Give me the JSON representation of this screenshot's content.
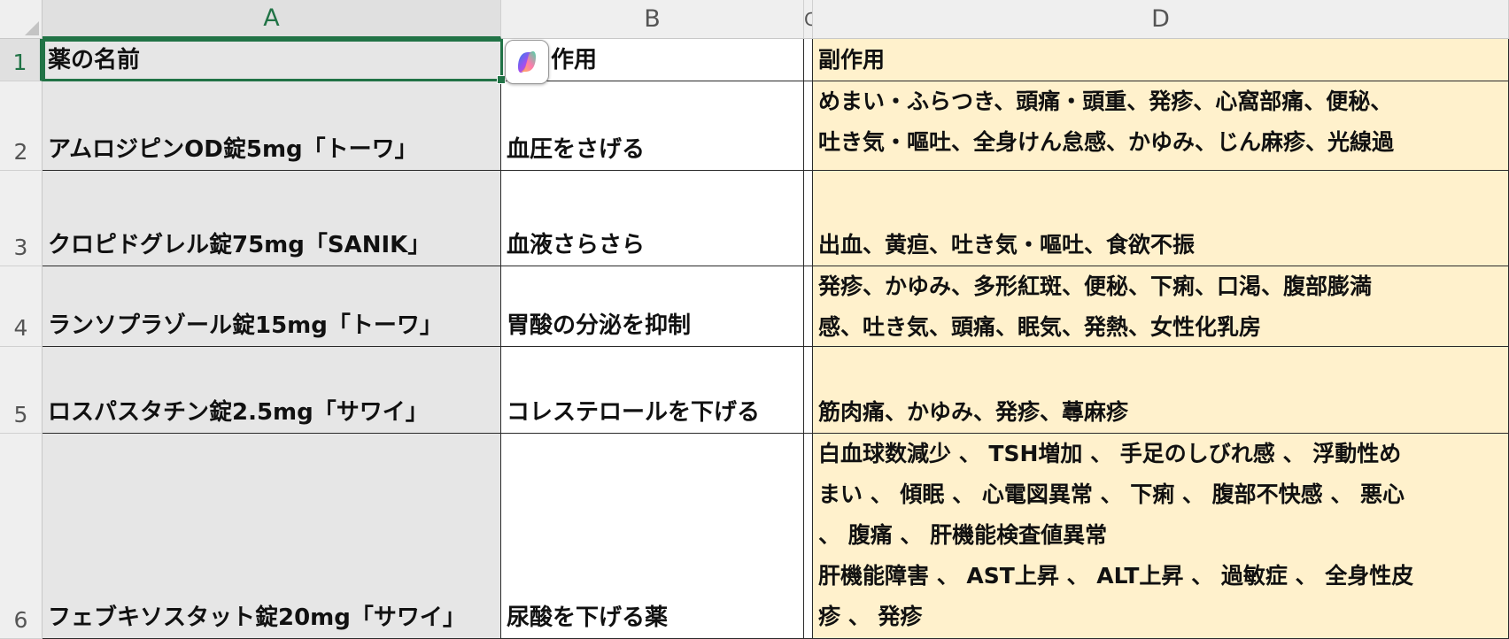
{
  "columns": [
    "A",
    "B",
    "C",
    "D"
  ],
  "rows": [
    "1",
    "2",
    "3",
    "4",
    "5",
    "6"
  ],
  "header": {
    "name": "薬の名前",
    "effect": "作用",
    "side_effects": "副作用"
  },
  "records": [
    {
      "name": "アムロジピンOD錠5mg「トーワ」",
      "effect": "血圧をさげる",
      "side_effects": "めまい・ふらつき、頭痛・頭重、発疹、心窩部痛、便秘、\n吐き気・嘔吐、全身けん怠感、かゆみ、じん麻疹、光線過"
    },
    {
      "name": "クロピドグレル錠75mg「SANIK」",
      "effect": "血液さらさら",
      "side_effects": "出血、黄疸、吐き気・嘔吐、食欲不振"
    },
    {
      "name": "ランソプラゾール錠15mg「トーワ」",
      "effect": "胃酸の分泌を抑制",
      "side_effects": "発疹、かゆみ、多形紅斑、便秘、下痢、口渇、腹部膨満\n感、吐き気、頭痛、眠気、発熱、女性化乳房"
    },
    {
      "name": "ロスパスタチン錠2.5mg「サワイ」",
      "effect": "コレステロールを下げる",
      "side_effects": "筋肉痛、かゆみ、発疹、蕁麻疹"
    },
    {
      "name": "フェブキソスタット錠20mg「サワイ」",
      "effect": "尿酸を下げる薬",
      "side_effects": "白血球数減少 、 TSH増加 、 手足のしびれ感 、 浮動性め\nまい 、 傾眠 、 心電図異常 、 下痢 、 腹部不快感 、 悪心\n、 腹痛 、 肝機能検査値異常\n肝機能障害 、 AST上昇 、 ALT上昇 、 過敏症 、 全身性皮\n疹 、 発疹"
    }
  ],
  "colors": {
    "selection": "#217346",
    "side_effect_fill": "#fff1cc",
    "name_fill": "#e6e6e6"
  },
  "icons": {
    "copilot": "copilot-icon"
  }
}
